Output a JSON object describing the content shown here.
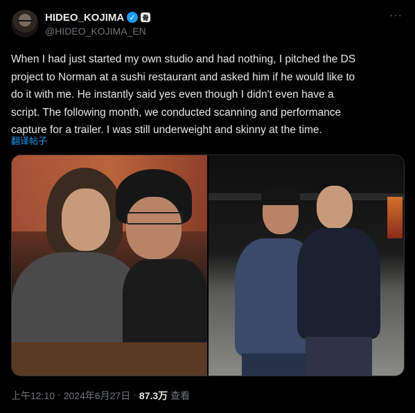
{
  "author": {
    "display_name": "HIDEO_KOJIMA",
    "handle": "@HIDEO_KOJIMA_EN",
    "verified_icon": "verified-badge-icon",
    "affiliation_icon": "affiliate-badge-icon",
    "affiliation_glyph": "骨"
  },
  "more_menu_glyph": "···",
  "tweet": {
    "text": "When I had just started my own studio and had nothing, I pitched the DS\nproject to Norman at a sushi restaurant and asked him if he would like to\ndo it with me. He instantly said yes even though I didn't even have a\nscript. The following month, we conducted scanning and performance\ncapture for a trailer. I was still underweight and skinny at the time.",
    "translate_label": "翻译帖子"
  },
  "media": {
    "count": 2
  },
  "meta": {
    "time": "上午12:10",
    "separator": "·",
    "date": "2024年6月27日",
    "separator2": "·",
    "views_count": "87.3万",
    "views_label": "查看"
  },
  "colors": {
    "background": "#000000",
    "text": "#e7e9ea",
    "secondary": "#71767b",
    "accent": "#1d9bf0",
    "border": "#2f3336"
  }
}
